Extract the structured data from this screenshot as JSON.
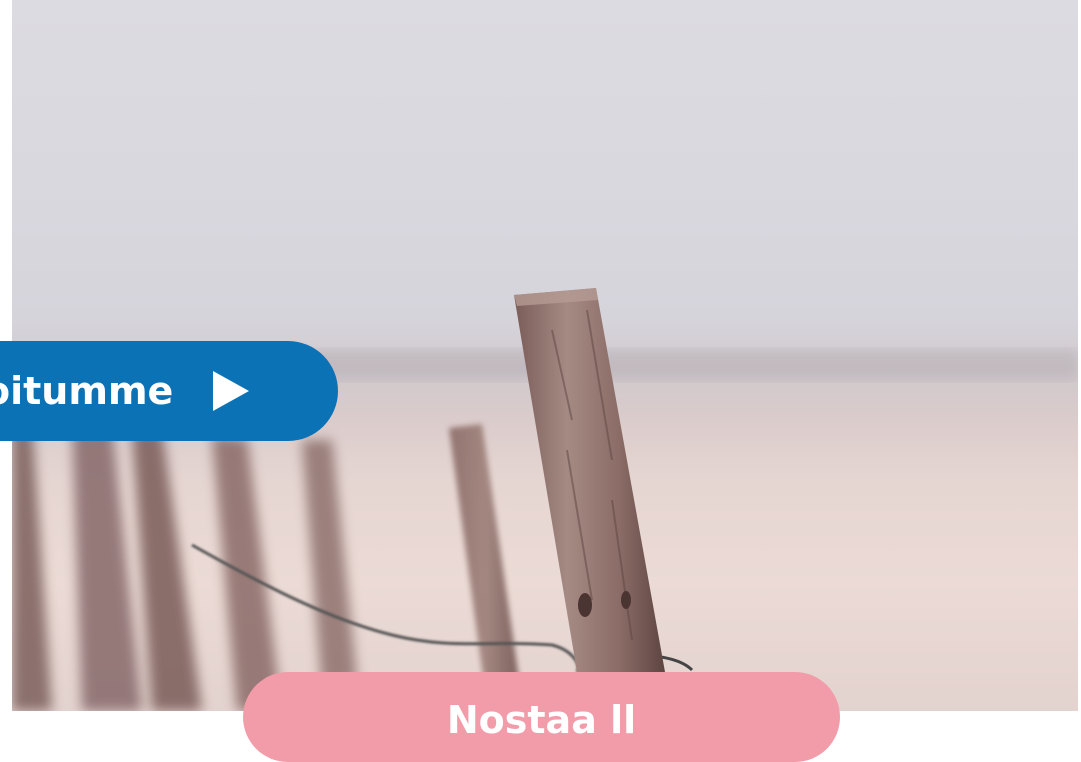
{
  "hero": {
    "image_alt": "Wooden fence posts on a beach"
  },
  "cta": {
    "label": "oitumme",
    "icon": "play-arrow-icon",
    "color": "#0b72b5"
  },
  "secondary_button": {
    "label": "Nostaa ll",
    "color": "#f29ca9"
  }
}
